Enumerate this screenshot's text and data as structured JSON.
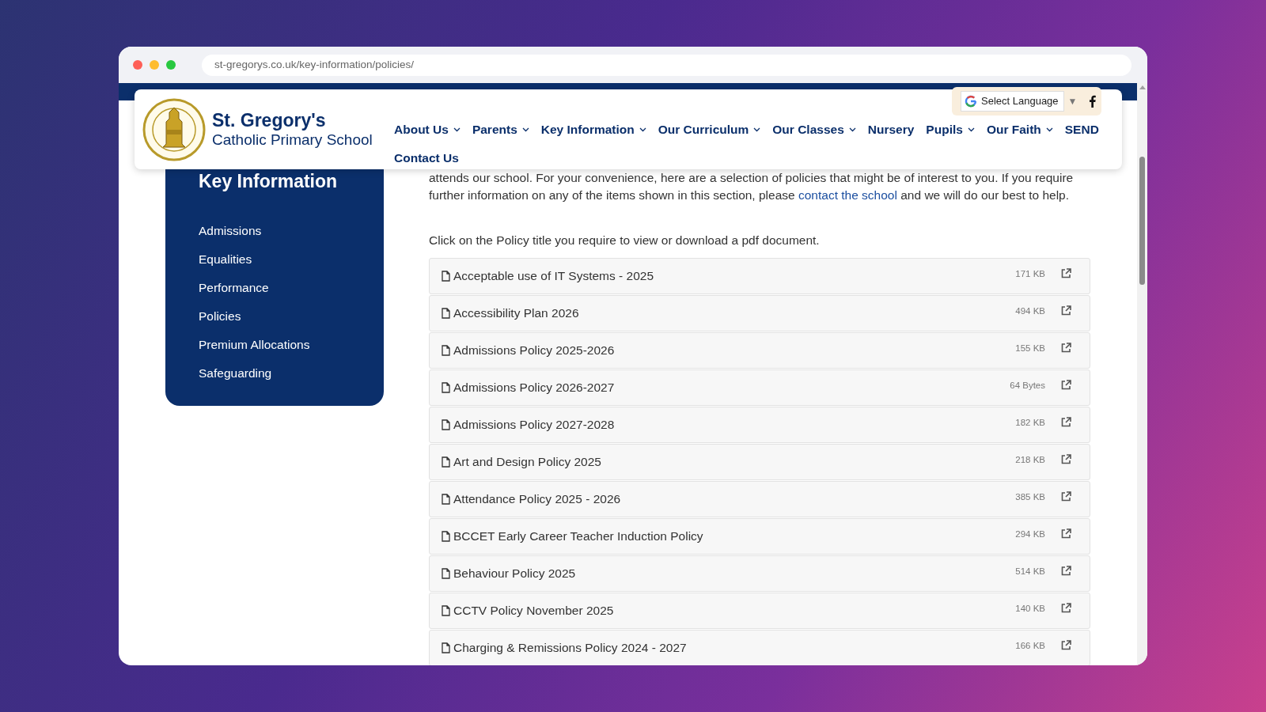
{
  "browser": {
    "url": "st-gregorys.co.uk/key-information/policies/"
  },
  "header": {
    "school_name": "St. Gregory's",
    "school_subtitle": "Catholic Primary School",
    "nav": [
      {
        "label": "About Us",
        "dropdown": true
      },
      {
        "label": "Parents",
        "dropdown": true
      },
      {
        "label": "Key Information",
        "dropdown": true
      },
      {
        "label": "Our Curriculum",
        "dropdown": true
      },
      {
        "label": "Our Classes",
        "dropdown": true
      },
      {
        "label": "Nursery",
        "dropdown": false
      },
      {
        "label": "Pupils",
        "dropdown": true
      },
      {
        "label": "Our Faith",
        "dropdown": true
      },
      {
        "label": "SEND",
        "dropdown": false
      },
      {
        "label": "Contact Us",
        "dropdown": false
      }
    ],
    "language": {
      "label": "Select Language",
      "arrow": "▼"
    }
  },
  "sidebar": {
    "title": "Key Information",
    "items": [
      "Admissions",
      "Equalities",
      "Performance",
      "Policies",
      "Premium Allocations",
      "Safeguarding"
    ]
  },
  "intro": {
    "text_before": "attends our school. For your convenience, here are a selection of policies that might be of interest to you. If you require further information on any of the items shown in this section, please ",
    "link": "contact the school",
    "text_after": " and we will do our best to help."
  },
  "instruction": "Click on the Policy title you require to view or download a pdf document.",
  "documents": [
    {
      "title": "Acceptable use of IT Systems - 2025",
      "size": "171 KB"
    },
    {
      "title": "Accessibility Plan 2026",
      "size": "494 KB"
    },
    {
      "title": "Admissions Policy 2025-2026",
      "size": "155 KB"
    },
    {
      "title": "Admissions Policy 2026-2027",
      "size": "64 Bytes"
    },
    {
      "title": "Admissions Policy 2027-2028",
      "size": "182 KB"
    },
    {
      "title": "Art and Design Policy 2025",
      "size": "218 KB"
    },
    {
      "title": "Attendance Policy 2025 - 2026",
      "size": "385 KB"
    },
    {
      "title": "BCCET Early Career Teacher Induction Policy",
      "size": "294 KB"
    },
    {
      "title": "Behaviour Policy 2025",
      "size": "514 KB"
    },
    {
      "title": "CCTV Policy November 2025",
      "size": "140 KB"
    },
    {
      "title": "Charging & Remissions Policy 2024 - 2027",
      "size": "166 KB"
    }
  ]
}
